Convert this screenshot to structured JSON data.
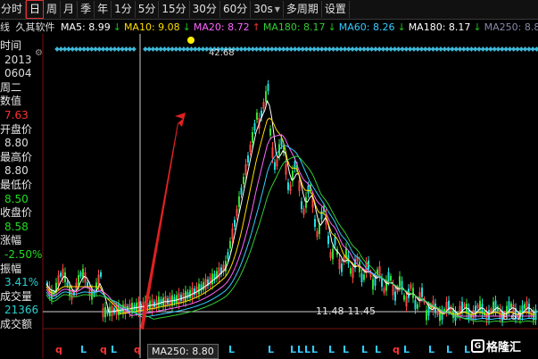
{
  "toolbar": {
    "items": [
      "分时",
      "日",
      "周",
      "月",
      "季",
      "年",
      "1分",
      "5分",
      "15分",
      "30分",
      "60分",
      "30s",
      "多周期",
      "设置"
    ],
    "active": "日",
    "period_select": "30s"
  },
  "ma_line": {
    "prefix": "线",
    "source": "久其软件",
    "items": [
      {
        "label": "MA5: 8.99",
        "color": "#ffffff",
        "dir": "down"
      },
      {
        "label": "MA10: 9.08",
        "color": "#ffdd00",
        "dir": "down"
      },
      {
        "label": "MA20: 8.72",
        "color": "#ff66ff",
        "dir": "up"
      },
      {
        "label": "MA180: 8.17",
        "color": "#33cc33",
        "dir": "down"
      },
      {
        "label": "MA60: 8.26",
        "color": "#33ccff",
        "dir": "down"
      },
      {
        "label": "MA180: 8.17",
        "color": "#ffffff",
        "dir": "down"
      },
      {
        "label": "MA250: 8.80",
        "color": "#8888aa",
        "dir": "down"
      }
    ]
  },
  "info": {
    "time_label": "时间",
    "date_year": "2013",
    "date_md": "0604",
    "weekday": "周二",
    "value_label": "数值",
    "value": "7.63",
    "open_label": "开盘价",
    "open": "8.80",
    "high_label": "最高价",
    "high": "8.80",
    "low_label": "最低价",
    "low": "8.50",
    "close_label": "收盘价",
    "close": "8.58",
    "change_label": "涨幅",
    "change": "-2.50%",
    "amp_label": "振幅",
    "amp": "3.41%",
    "vol_label": "成交量",
    "vol": "21366",
    "amount_label": "成交额"
  },
  "annotations": {
    "peak_label": "42.68",
    "range_label": "11.48-11.45",
    "right_price": "8.67",
    "ma250_tag": "MA250: 8.80",
    "logo": "格隆汇"
  },
  "colors": {
    "background": "#000000",
    "grid_red": "#7a1010",
    "cyan_signal": "#3fb8d8",
    "arrow": "#e02020"
  },
  "icons": {
    "settings": "gear-icon",
    "chevron": "chevron-down-icon"
  }
}
